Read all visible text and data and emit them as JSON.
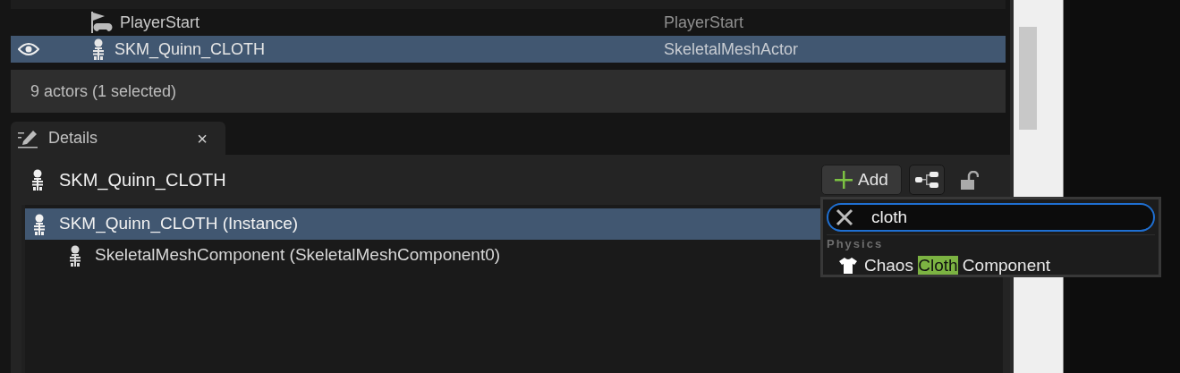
{
  "outliner": {
    "rows": [
      {
        "label": "PlayerStart",
        "type": "PlayerStart",
        "kind": "player_start",
        "visible": false,
        "selected": false
      },
      {
        "label": "SKM_Quinn_CLOTH",
        "type": "SkeletalMeshActor",
        "kind": "skeletal_mesh",
        "visible": true,
        "selected": true
      }
    ],
    "status": "9 actors (1 selected)"
  },
  "details": {
    "tab": {
      "label": "Details",
      "close": "×"
    },
    "actor_name": "SKM_Quinn_CLOTH",
    "add_button": "Add",
    "locked": false,
    "components": [
      {
        "label": "SKM_Quinn_CLOTH (Instance)",
        "selected": true,
        "children": [
          {
            "label": "SkeletalMeshComponent (SkeletalMeshComponent0)",
            "selected": false
          }
        ]
      }
    ]
  },
  "add_menu": {
    "search": "cloth",
    "category": "Physics",
    "results": [
      {
        "before": "Chaos ",
        "match": "Cloth",
        "after": " Component"
      }
    ]
  }
}
